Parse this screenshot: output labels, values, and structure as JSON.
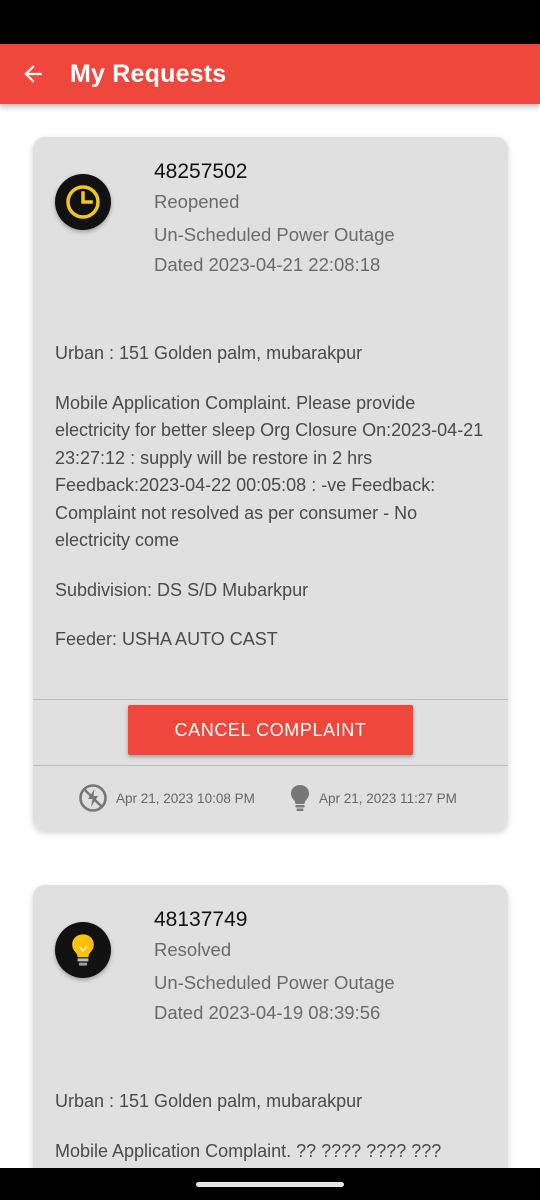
{
  "appbar": {
    "title": "My Requests"
  },
  "requests": [
    {
      "id": "48257502",
      "status": "Reopened",
      "type": "Un-Scheduled Power Outage",
      "dated": "Dated 2023-04-21 22:08:18",
      "address": "Urban : 151 Golden palm, mubarakpur",
      "description": "Mobile Application Complaint. Please provide electricity for better sleep Org Closure On:2023-04-21 23:27:12 : supply will be restore in 2 hrs Feedback:2023-04-22 00:05:08 : -ve Feedback: Complaint not resolved as per consumer - No electricity come",
      "subdivision": "Subdivision: DS S/D Mubarkpur",
      "feeder": "Feeder: USHA AUTO CAST",
      "cancel_label": "CANCEL COMPLAINT",
      "outage_time": "Apr 21, 2023 10:08 PM",
      "restored_time": "Apr 21, 2023 11:27 PM",
      "icon": "clock-icon",
      "icon_color": "#f5c518"
    },
    {
      "id": "48137749",
      "status": "Resolved",
      "type": "Un-Scheduled Power Outage",
      "dated": "Dated 2023-04-19 08:39:56",
      "address": "Urban : 151 Golden palm, mubarakpur",
      "description": "Mobile Application Complaint. ?? ???? ???? ???",
      "icon": "lightbulb-icon",
      "icon_color": "#ffb300"
    }
  ],
  "colors": {
    "accent": "#f0473c",
    "card": "#e0e0e0"
  }
}
